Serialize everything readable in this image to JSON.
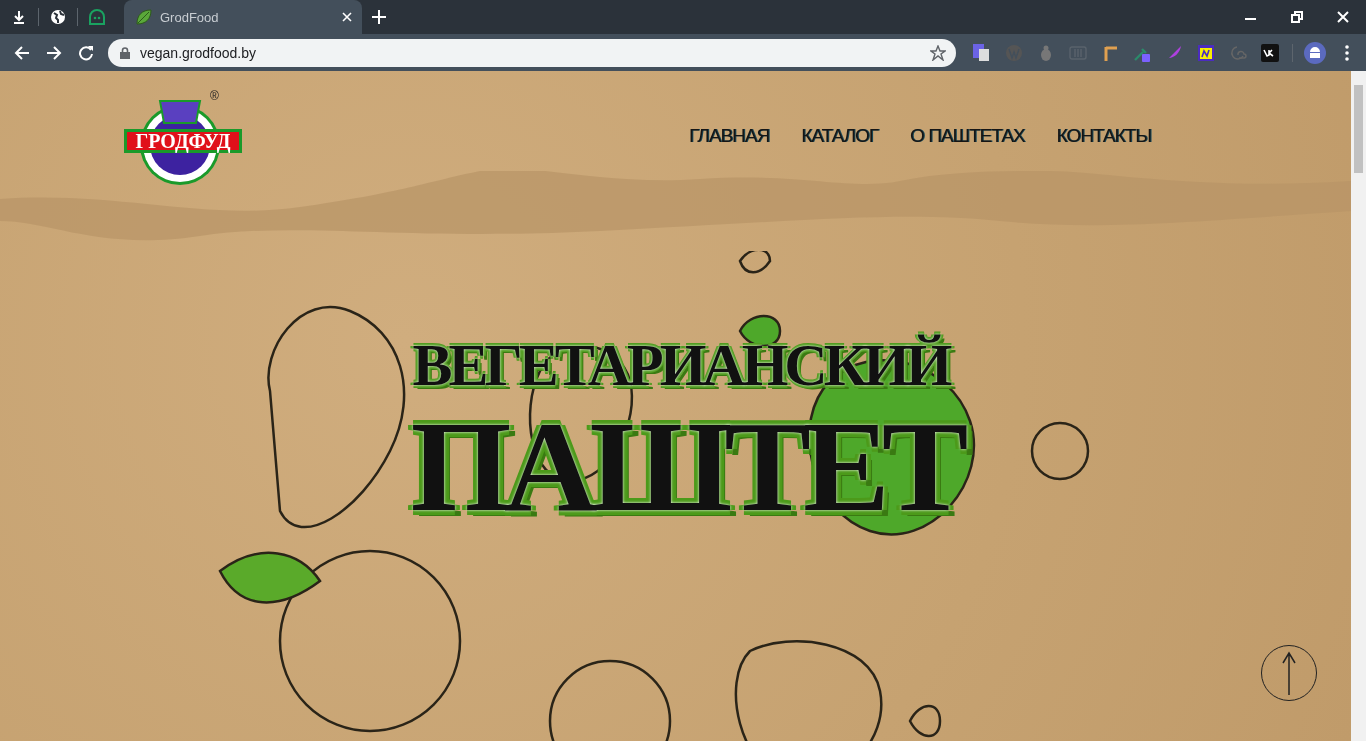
{
  "browser": {
    "tabs": [
      {
        "title": "GrodFood",
        "selected": true
      }
    ],
    "address": "vegan.grodfood.by"
  },
  "site": {
    "logo": {
      "text": "ГРОДФУД",
      "registered": "®"
    },
    "nav": [
      {
        "label": "ГЛАВНАЯ"
      },
      {
        "label": "КАТАЛОГ"
      },
      {
        "label": "О ПАШТЕТАХ"
      },
      {
        "label": "КОНТАКТЫ"
      }
    ],
    "hero": {
      "line_1": "ВЕГЕТАРИАНСКИЙ",
      "line_2": "ПАШТЕТ"
    }
  }
}
